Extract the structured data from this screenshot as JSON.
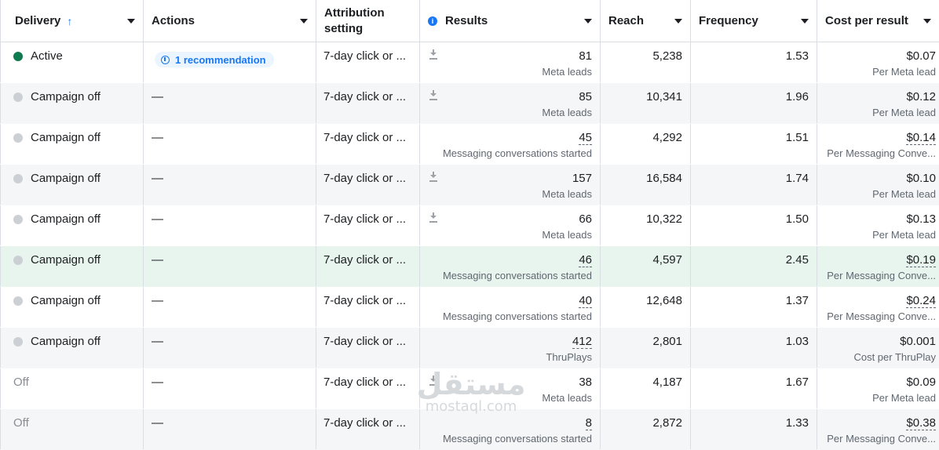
{
  "columns": {
    "delivery": "Delivery",
    "actions": "Actions",
    "attribution": "Attribution setting",
    "results": "Results",
    "reach": "Reach",
    "frequency": "Frequency",
    "cost_per_result": "Cost per result"
  },
  "rows": [
    {
      "delivery": "Active",
      "status": "active",
      "action": "1 recommendation",
      "attribution": "7-day click or ...",
      "results": "81",
      "results_sub": "Meta leads",
      "reach": "5,238",
      "frequency": "1.53",
      "cost": "$0.07",
      "cost_sub": "Per Meta lead"
    },
    {
      "delivery": "Campaign off",
      "status": "off",
      "action": "—",
      "attribution": "7-day click or ...",
      "results": "85",
      "results_sub": "Meta leads",
      "reach": "10,341",
      "frequency": "1.96",
      "cost": "$0.12",
      "cost_sub": "Per Meta lead"
    },
    {
      "delivery": "Campaign off",
      "status": "off",
      "action": "—",
      "attribution": "7-day click or ...",
      "results": "45",
      "results_sub": "Messaging conversations started",
      "reach": "4,292",
      "frequency": "1.51",
      "cost": "$0.14",
      "cost_sub": "Per Messaging Conve..."
    },
    {
      "delivery": "Campaign off",
      "status": "off",
      "action": "—",
      "attribution": "7-day click or ...",
      "results": "157",
      "results_sub": "Meta leads",
      "reach": "16,584",
      "frequency": "1.74",
      "cost": "$0.10",
      "cost_sub": "Per Meta lead"
    },
    {
      "delivery": "Campaign off",
      "status": "off",
      "action": "—",
      "attribution": "7-day click or ...",
      "results": "66",
      "results_sub": "Meta leads",
      "reach": "10,322",
      "frequency": "1.50",
      "cost": "$0.13",
      "cost_sub": "Per Meta lead"
    },
    {
      "delivery": "Campaign off",
      "status": "off",
      "action": "—",
      "attribution": "7-day click or ...",
      "results": "46",
      "results_sub": "Messaging conversations started",
      "reach": "4,597",
      "frequency": "2.45",
      "cost": "$0.19",
      "cost_sub": "Per Messaging Conve..."
    },
    {
      "delivery": "Campaign off",
      "status": "off",
      "action": "—",
      "attribution": "7-day click or ...",
      "results": "40",
      "results_sub": "Messaging conversations started",
      "reach": "12,648",
      "frequency": "1.37",
      "cost": "$0.24",
      "cost_sub": "Per Messaging Conve..."
    },
    {
      "delivery": "Campaign off",
      "status": "off",
      "action": "—",
      "attribution": "7-day click or ...",
      "results": "412",
      "results_sub": "ThruPlays",
      "reach": "2,801",
      "frequency": "1.03",
      "cost": "$0.001",
      "cost_sub": "Cost per ThruPlay"
    },
    {
      "delivery": "Off",
      "status": "plain",
      "action": "—",
      "attribution": "7-day click or ...",
      "results": "38",
      "results_sub": "Meta leads",
      "reach": "4,187",
      "frequency": "1.67",
      "cost": "$0.09",
      "cost_sub": "Per Meta lead"
    },
    {
      "delivery": "Off",
      "status": "plain",
      "action": "—",
      "attribution": "7-day click or ...",
      "results": "8",
      "results_sub": "Messaging conversations started",
      "reach": "2,872",
      "frequency": "1.33",
      "cost": "$0.38",
      "cost_sub": "Per Messaging Conve..."
    }
  ],
  "watermark": {
    "arabic": "مستقل",
    "latin": "mostaql.com"
  },
  "colors": {
    "accent": "#1877f2",
    "active": "#0e7a4d",
    "highlight": "#e8f4ee"
  }
}
